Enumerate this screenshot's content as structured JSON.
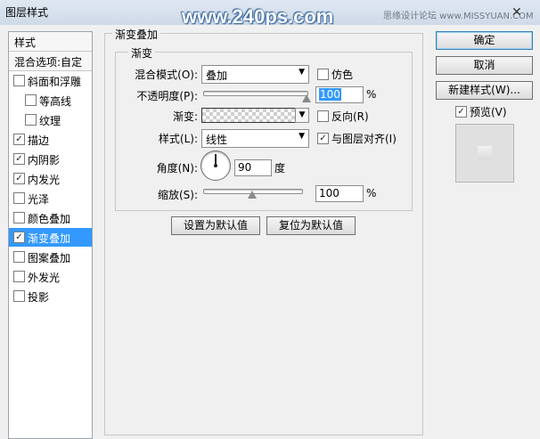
{
  "window": {
    "title": "图层样式",
    "watermark": "www.240ps.com",
    "watermark_sub": "思缘设计论坛 www.MISSYUAN.COM",
    "close_glyph": "✕"
  },
  "sidebar": {
    "header_styles": "样式",
    "header_blend": "混合选项:自定",
    "items": [
      {
        "label": "斜面和浮雕",
        "checked": false
      },
      {
        "label": "等高线",
        "checked": false
      },
      {
        "label": "纹理",
        "checked": false
      },
      {
        "label": "描边",
        "checked": true
      },
      {
        "label": "内阴影",
        "checked": true
      },
      {
        "label": "内发光",
        "checked": true
      },
      {
        "label": "光泽",
        "checked": false
      },
      {
        "label": "颜色叠加",
        "checked": false
      },
      {
        "label": "渐变叠加",
        "checked": true
      },
      {
        "label": "图案叠加",
        "checked": false
      },
      {
        "label": "外发光",
        "checked": false
      },
      {
        "label": "投影",
        "checked": false
      }
    ]
  },
  "panel": {
    "group_title": "渐变叠加",
    "subgroup_title": "渐变",
    "blend_mode_label": "混合模式(O):",
    "blend_mode_value": "叠加",
    "dither_label": "仿色",
    "dither_checked": false,
    "opacity_label": "不透明度(P):",
    "opacity_value": "100",
    "opacity_fraction": 1.0,
    "percent": "%",
    "gradient_label": "渐变:",
    "reverse_label": "反向(R)",
    "reverse_checked": false,
    "style_label": "样式(L):",
    "style_value": "线性",
    "align_label": "与图层对齐(I)",
    "align_checked": true,
    "angle_label": "角度(N):",
    "angle_value": "90",
    "angle_unit": "度",
    "scale_label": "缩放(S):",
    "scale_value": "100",
    "scale_fraction": 0.5,
    "reset_default_button": "设置为默认值",
    "restore_default_button": "复位为默认值"
  },
  "right": {
    "ok_button": "确定",
    "cancel_button": "取消",
    "new_style_button": "新建样式(W)...",
    "preview_label": "预览(V)",
    "preview_checked": true
  },
  "icons": {
    "checkmark": "✓",
    "dropdown": "▼"
  }
}
